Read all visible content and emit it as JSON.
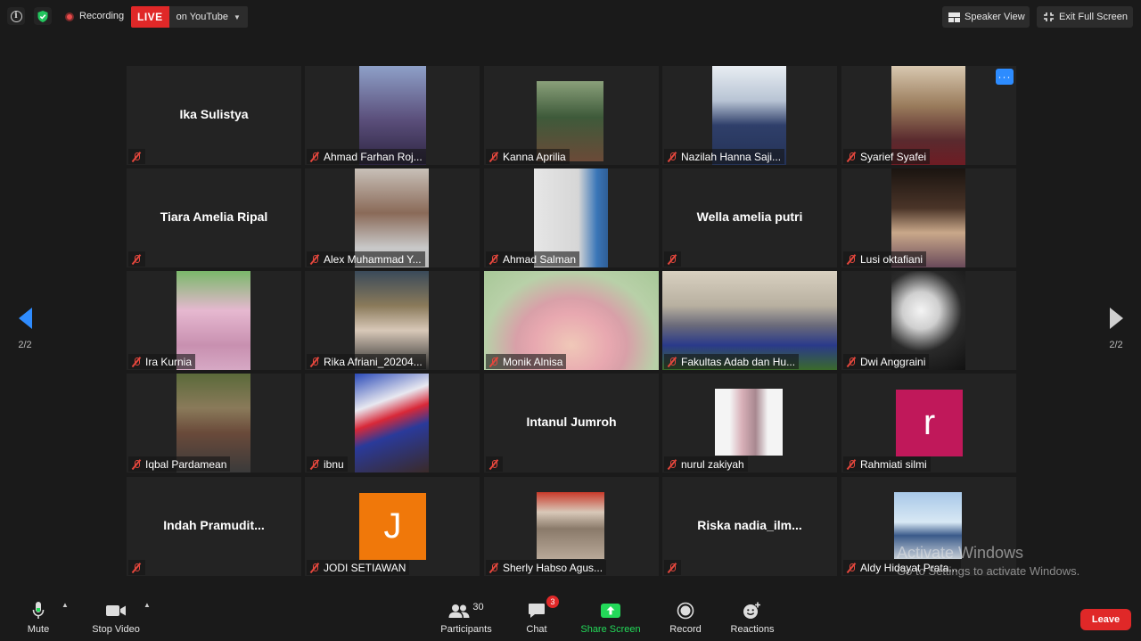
{
  "top_bar": {
    "recording_label": "Recording",
    "live_label": "LIVE",
    "live_destination": "on YouTube",
    "speaker_view_label": "Speaker View",
    "exit_fullscreen_label": "Exit Full Screen"
  },
  "navigation": {
    "page_left": "2/2",
    "page_right": "2/2"
  },
  "tiles": [
    {
      "name": "Ika Sulistya",
      "video": false
    },
    {
      "name": "Ahmad Farhan Roj...",
      "video": true
    },
    {
      "name": "Kanna Aprilia",
      "video": true
    },
    {
      "name": "Nazilah Hanna Saji...",
      "video": true
    },
    {
      "name": "Syarief Syafei",
      "video": true,
      "more_button": "···"
    },
    {
      "name": "Tiara Amelia Ripal",
      "video": false
    },
    {
      "name": "Alex Muhammad Y...",
      "video": true
    },
    {
      "name": "Ahmad Salman",
      "video": true
    },
    {
      "name": "Wella amelia putri",
      "video": false
    },
    {
      "name": "Lusi oktafiani",
      "video": true
    },
    {
      "name": "Ira Kurnia",
      "video": true
    },
    {
      "name": "Rika Afriani_20204...",
      "video": true
    },
    {
      "name": "Monik Alnisa",
      "video": true
    },
    {
      "name": "Fakultas Adab dan Hu...",
      "video": true
    },
    {
      "name": "Dwi Anggraini",
      "video": true
    },
    {
      "name": "Iqbal Pardamean",
      "video": true
    },
    {
      "name": "ibnu",
      "video": true
    },
    {
      "name": "Intanul Jumroh",
      "video": false
    },
    {
      "name": "nurul zakiyah",
      "video": true
    },
    {
      "name": "Rahmiati silmi",
      "video": false,
      "avatar_letter": "r",
      "avatar_color": "#c0185a"
    },
    {
      "name": "Indah  Pramudit...",
      "video": false
    },
    {
      "name": "JODI SETIAWAN",
      "video": false,
      "avatar_letter": "J",
      "avatar_color": "#f0780a"
    },
    {
      "name": "Sherly Habso Agus...",
      "video": true
    },
    {
      "name": "Riska  nadia_ilm...",
      "video": false
    },
    {
      "name": "Aldy Hidayat Prata...",
      "video": true
    }
  ],
  "toolbar": {
    "mute_label": "Mute",
    "stop_video_label": "Stop Video",
    "participants_label": "Participants",
    "participants_count": "30",
    "chat_label": "Chat",
    "chat_badge": "3",
    "share_label": "Share Screen",
    "record_label": "Record",
    "reactions_label": "Reactions",
    "leave_label": "Leave"
  },
  "watermark": {
    "title": "Activate Windows",
    "subtitle": "Go to Settings to activate Windows."
  },
  "colors": {
    "accent": "#2d8cff",
    "live": "#e02828",
    "share": "#23d959",
    "muted": "#e5473d"
  }
}
